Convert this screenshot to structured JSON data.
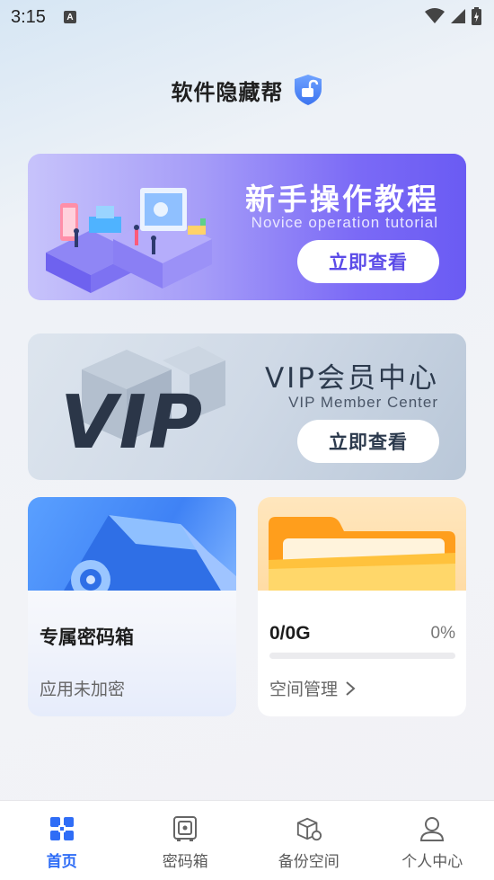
{
  "status": {
    "time": "3:15",
    "a_badge": "A"
  },
  "header": {
    "title": "软件隐藏帮"
  },
  "tutorial_banner": {
    "title": "新手操作教程",
    "subtitle": "Novice operation tutorial",
    "button": "立即查看"
  },
  "vip_banner": {
    "title": "VIP会员中心",
    "subtitle": "VIP Member Center",
    "big_logo": "VIP",
    "button": "立即查看"
  },
  "safe_card": {
    "title": "专属密码箱",
    "status": "应用未加密"
  },
  "space_card": {
    "usage": "0/0G",
    "percent": "0%",
    "usage_fraction": 0,
    "link": "空间管理"
  },
  "tabs": [
    {
      "label": "首页",
      "icon": "home-grid-icon",
      "active": true
    },
    {
      "label": "密码箱",
      "icon": "safe-icon",
      "active": false
    },
    {
      "label": "备份空间",
      "icon": "backup-box-icon",
      "active": false
    },
    {
      "label": "个人中心",
      "icon": "user-icon",
      "active": false
    }
  ],
  "colors": {
    "accent": "#2f6df6",
    "tutorial_purple": "#6a5bf3",
    "vip_dark": "#2c3a4d"
  }
}
